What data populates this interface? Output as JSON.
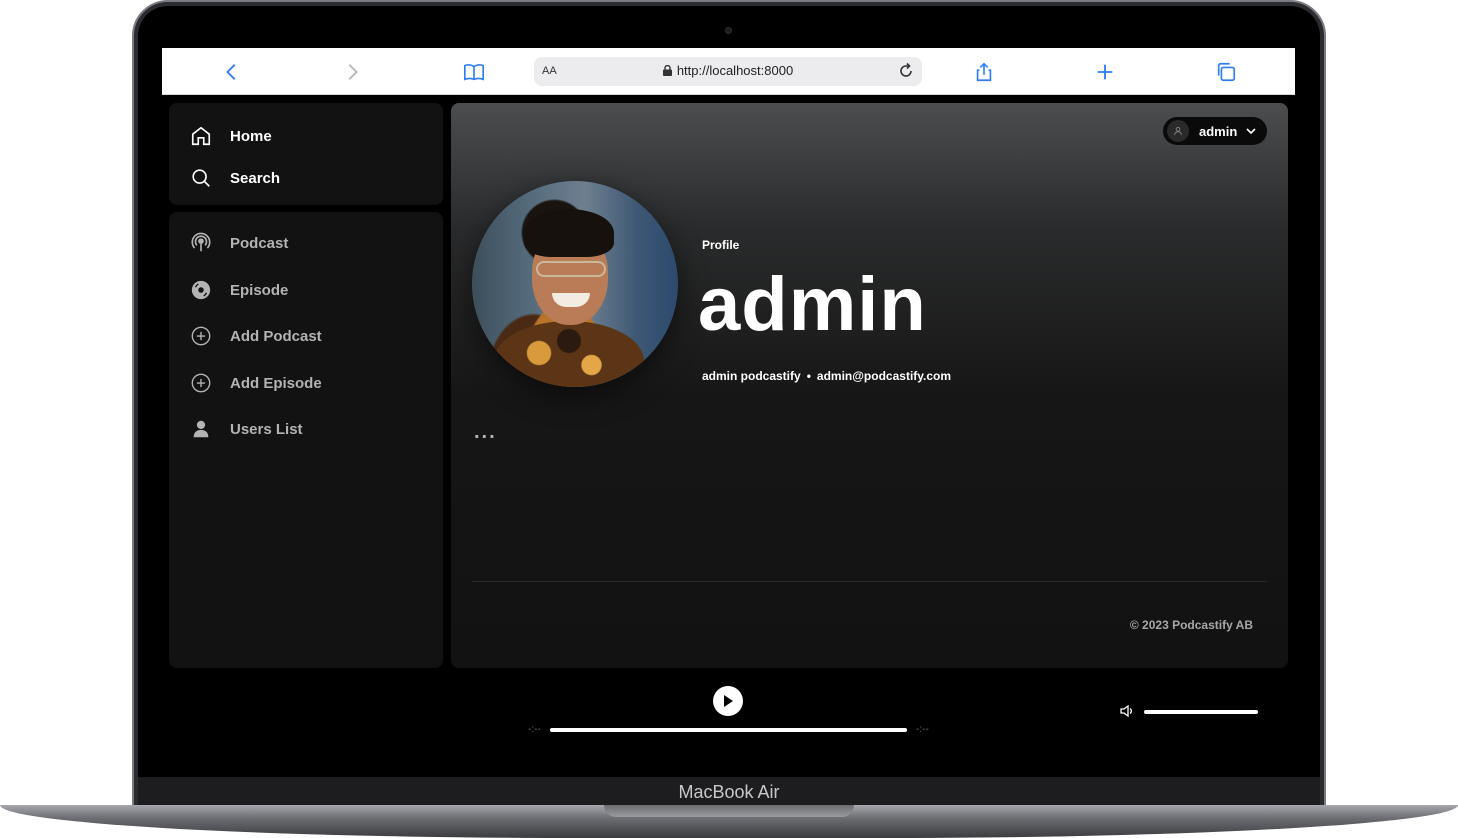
{
  "device": {
    "label": "MacBook Air"
  },
  "browser": {
    "reader_label": "AA",
    "url": "http://localhost:8000",
    "accent_color": "#2f7cf6"
  },
  "sidebar": {
    "top_items": [
      {
        "label": "Home",
        "icon": "home-icon"
      },
      {
        "label": "Search",
        "icon": "search-icon"
      }
    ],
    "library_items": [
      {
        "label": "Podcast",
        "icon": "podcast-icon"
      },
      {
        "label": "Episode",
        "icon": "episode-icon"
      },
      {
        "label": "Add Podcast",
        "icon": "add-circle-icon"
      },
      {
        "label": "Add Episode",
        "icon": "add-circle-icon"
      },
      {
        "label": "Users List",
        "icon": "user-icon"
      }
    ]
  },
  "header": {
    "user_name": "admin"
  },
  "profile": {
    "type_label": "Profile",
    "name": "admin",
    "full_name": "admin podcastify",
    "separator": "•",
    "email": "admin@podcastify.com",
    "more_label": "..."
  },
  "footer": {
    "copyright": "© 2023 Podcastify AB"
  },
  "player": {
    "elapsed": "-:--",
    "remaining": "-:--",
    "progress": 1.0,
    "volume": 1.0
  }
}
